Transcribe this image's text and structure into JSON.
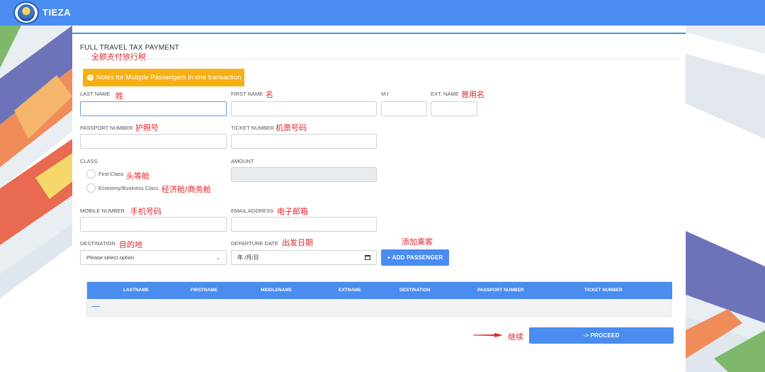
{
  "header": {
    "brand": "TIEZA",
    "logo_icon": "tieza-seal"
  },
  "form": {
    "title": "FULL TRAVEL TAX PAYMENT",
    "title_cn": "全额支付旅行税",
    "notice": "Notes for Multiple Passengers in one transaction",
    "last_name": {
      "label": "LAST NAME",
      "cn": "姓",
      "value": ""
    },
    "first_name": {
      "label": "FIRST NAME",
      "cn": "名",
      "value": ""
    },
    "mi": {
      "label": "M.I",
      "value": ""
    },
    "ext_name": {
      "label": "EXT. NAME",
      "cn": "曾用名",
      "value": ""
    },
    "passport": {
      "label": "PASSPORT NUMBER",
      "cn": "护照号",
      "value": ""
    },
    "ticket": {
      "label": "TICKET NUMBER",
      "cn": "机票号码",
      "value": ""
    },
    "class": {
      "label": "CLASS",
      "options": [
        {
          "label": "First Class",
          "cn": "头等舱"
        },
        {
          "label": "Economy/Business Class",
          "cn": "经济舱/商务舱"
        }
      ]
    },
    "amount": {
      "label": "AMOUNT",
      "value": ""
    },
    "mobile": {
      "label": "MOBILE NUMBER",
      "cn": "手机号码",
      "value": ""
    },
    "email": {
      "label": "EMAIL ADDRESS",
      "cn": "电子邮箱",
      "value": ""
    },
    "destination": {
      "label": "DESTINATION",
      "cn": "目的地",
      "selected": "Please select option"
    },
    "departure": {
      "label": "DEPARTURE DATE",
      "cn": "出发日期",
      "value": "年 /月/日"
    },
    "add_passenger": {
      "label": "+  ADD PASSENGER",
      "cn": "添加乘客"
    }
  },
  "table": {
    "columns": [
      "LASTNAME",
      "FIRSTNAME",
      "MIDDLENAME",
      "EXTNAME",
      "DESTINATION",
      "PASSPORT NUMBER",
      "TICKET NUMBER"
    ],
    "rows": []
  },
  "proceed": {
    "label": "-> PROCEED",
    "cn": "继续"
  },
  "colors": {
    "primary": "#4a8cf0",
    "notice": "#f5b014",
    "annotation": "#e0262e"
  }
}
